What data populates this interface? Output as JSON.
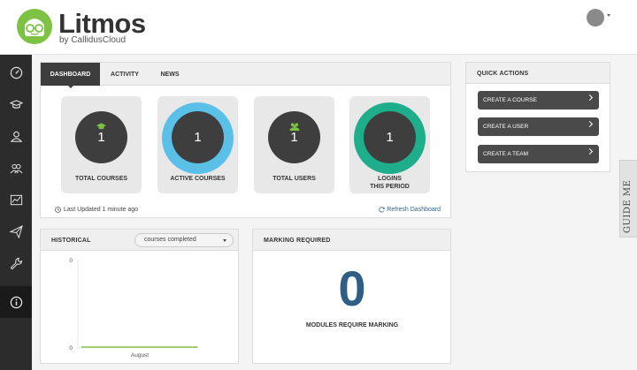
{
  "brand": {
    "name": "Litmos",
    "subtitle": "by CallidusCloud"
  },
  "sidebar": {
    "items": [
      {
        "icon": "dashboard-icon"
      },
      {
        "icon": "graduation-cap-icon"
      },
      {
        "icon": "user-icon"
      },
      {
        "icon": "users-icon"
      },
      {
        "icon": "chart-icon"
      },
      {
        "icon": "paper-plane-icon"
      },
      {
        "icon": "wrench-icon"
      },
      {
        "icon": "info-icon",
        "active": true
      }
    ]
  },
  "dashboard": {
    "tabs": [
      {
        "label": "DASHBOARD",
        "active": true
      },
      {
        "label": "ACTIVITY"
      },
      {
        "label": "NEWS"
      }
    ],
    "stats": [
      {
        "value": "1",
        "label": "TOTAL COURSES",
        "ring_color": "#e8e8e8",
        "icon": "graduation-cap-icon"
      },
      {
        "value": "1",
        "label": "ACTIVE COURSES",
        "ring_color": "#5bc0e8",
        "icon": ""
      },
      {
        "value": "1",
        "label": "TOTAL USERS",
        "ring_color": "#e8e8e8",
        "icon": "users-icon"
      },
      {
        "value": "1",
        "label_line1": "LOGINS",
        "label_line2": "THIS PERIOD",
        "ring_color": "#1fae8c",
        "icon": ""
      }
    ],
    "last_updated": "Last Updated 1 minute ago",
    "refresh": "Refresh Dashboard"
  },
  "quick_actions": {
    "title": "QUICK ACTIONS",
    "buttons": [
      "CREATE A COURSE",
      "CREATE A USER",
      "CREATE A TEAM"
    ]
  },
  "historical": {
    "title": "HISTORICAL",
    "select_value": "courses completed",
    "y_top": "0",
    "y_bottom": "0",
    "x_label": "August",
    "line_color": "#8bc34a"
  },
  "marking": {
    "title": "MARKING REQUIRED",
    "count": "0",
    "label": "MODULES REQUIRE MARKING"
  },
  "guide": {
    "label": "GUIDE ME"
  }
}
